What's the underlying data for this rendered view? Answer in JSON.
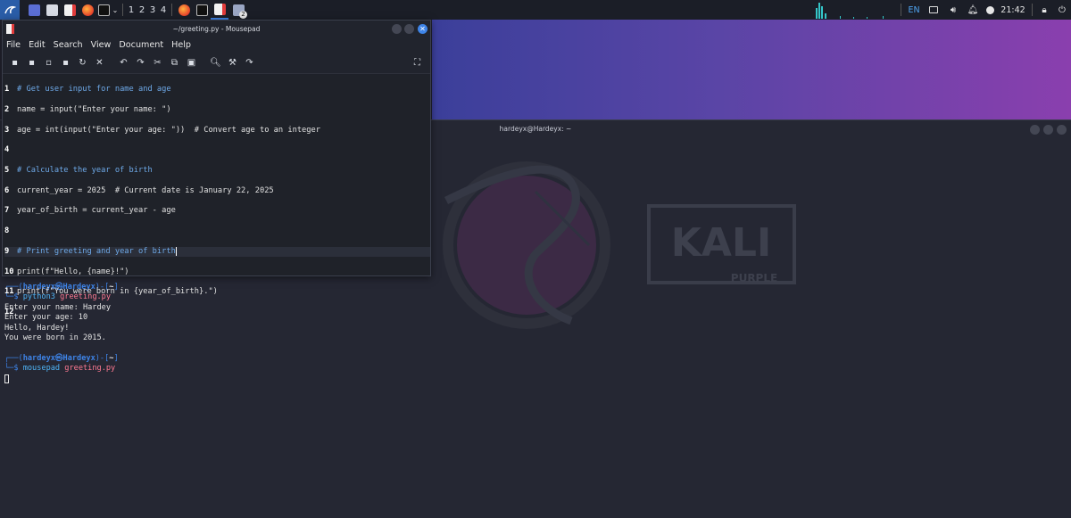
{
  "panel": {
    "workspaces": [
      "1",
      "2",
      "3",
      "4"
    ],
    "keyboard_layout": "EN",
    "clock": "21:42",
    "notification_count": "2"
  },
  "mousepad": {
    "title": "~/greeting.py - Mousepad",
    "menu": [
      "File",
      "Edit",
      "Search",
      "View",
      "Document",
      "Help"
    ],
    "code_lines": [
      {
        "n": "1",
        "text": "# Get user input for name and age"
      },
      {
        "n": "2",
        "text": "name = input(\"Enter your name: \")"
      },
      {
        "n": "3",
        "text": "age = int(input(\"Enter your age: \"))  # Convert age to an integer"
      },
      {
        "n": "4",
        "text": ""
      },
      {
        "n": "5",
        "text": "# Calculate the year of birth"
      },
      {
        "n": "6",
        "text": "current_year = 2025  # Current date is January 22, 2025"
      },
      {
        "n": "7",
        "text": "year_of_birth = current_year - age"
      },
      {
        "n": "8",
        "text": ""
      },
      {
        "n": "9",
        "text": "# Print greeting and year of birth"
      },
      {
        "n": "10",
        "text": "print(f\"Hello, {name}!\")"
      },
      {
        "n": "11",
        "text": "print(f\"You were born in {year_of_birth}.\")"
      },
      {
        "n": "12",
        "text": ""
      }
    ]
  },
  "terminal": {
    "title": "hardeyx@Hardeyx: ~",
    "prompt_user": "hardeyx",
    "prompt_host": "Hardeyx",
    "prompt_dir": "~",
    "cmd1": "python3",
    "cmd1_arg": "greeting.py",
    "output": [
      "Enter your name: Hardey",
      "Enter your age: 10",
      "Hello, Hardey!",
      "You were born in 2015."
    ],
    "cmd2": "mousepad",
    "cmd2_arg": "greeting.py"
  },
  "wallpaper": {
    "logo": "KALI",
    "sub": "PURPLE"
  },
  "colors": {
    "accent": "#3e84e8",
    "purple": "#8a3fae"
  }
}
